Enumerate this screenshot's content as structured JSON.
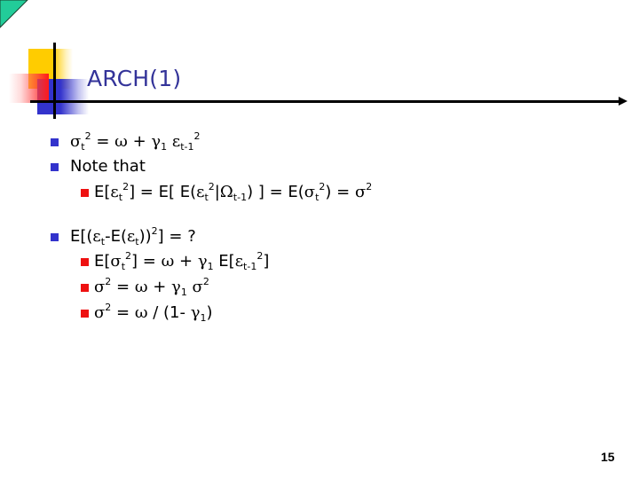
{
  "slide": {
    "title": "ARCH(1)",
    "page_number": "15",
    "colors": {
      "title": "#333399",
      "bullet_level1": "#3333cc",
      "bullet_level2": "#ee1111",
      "corner_triangle": "#22cc99"
    },
    "bullets": [
      {
        "level": 1,
        "parts": [
          {
            "t": "σ",
            "g": true
          },
          {
            "sub": "t"
          },
          {
            "sup": "2"
          },
          {
            "t": " = "
          },
          {
            "t": "ω",
            "g": true
          },
          {
            "t": " + "
          },
          {
            "t": "γ",
            "g": true
          },
          {
            "sub": "1"
          },
          {
            "t": " "
          },
          {
            "t": "ε",
            "g": true
          },
          {
            "sub": "t-1"
          },
          {
            "sup": "2"
          }
        ],
        "text": "σt2 = ω + γ1 εt-12"
      },
      {
        "level": 1,
        "parts": [
          {
            "t": "Note that"
          }
        ],
        "text": "Note that"
      },
      {
        "level": 2,
        "parts": [
          {
            "t": "E["
          },
          {
            "t": "ε",
            "g": true
          },
          {
            "sub": "t"
          },
          {
            "sup": "2"
          },
          {
            "t": "] = E[ E("
          },
          {
            "t": "ε",
            "g": true
          },
          {
            "sub": "t"
          },
          {
            "sup": "2"
          },
          {
            "t": "|"
          },
          {
            "t": "Ω",
            "g": true
          },
          {
            "sub": "t-1"
          },
          {
            "t": ") ] = E("
          },
          {
            "t": "σ",
            "g": true
          },
          {
            "sub": "t"
          },
          {
            "sup": "2"
          },
          {
            "t": ") = "
          },
          {
            "t": "σ",
            "g": true
          },
          {
            "sup": "2"
          }
        ],
        "text": "E[εt2] = E[ E(εt2|Ωt-1) ] = E(σt2) = σ2"
      },
      {
        "level": 1,
        "parts": [
          {
            "t": "E[("
          },
          {
            "t": "ε",
            "g": true
          },
          {
            "sub": "t"
          },
          {
            "t": "-E("
          },
          {
            "t": "ε",
            "g": true
          },
          {
            "sub": "t"
          },
          {
            "t": "))"
          },
          {
            "sup": "2"
          },
          {
            "t": "] = ?"
          }
        ],
        "text": "E[(εt-E(εt))2] = ?"
      },
      {
        "level": 2,
        "parts": [
          {
            "t": "E["
          },
          {
            "t": "σ",
            "g": true
          },
          {
            "sub": "t"
          },
          {
            "sup": "2"
          },
          {
            "t": "] = "
          },
          {
            "t": "ω",
            "g": true
          },
          {
            "t": " + "
          },
          {
            "t": "γ",
            "g": true
          },
          {
            "sub": "1"
          },
          {
            "t": " E["
          },
          {
            "t": "ε",
            "g": true
          },
          {
            "sub": "t-1"
          },
          {
            "sup": "2"
          },
          {
            "t": "]"
          }
        ],
        "text": "E[σt2] = ω + γ1 E[εt-12]"
      },
      {
        "level": 2,
        "parts": [
          {
            "t": "σ",
            "g": true
          },
          {
            "sup": "2"
          },
          {
            "t": " = "
          },
          {
            "t": "ω",
            "g": true
          },
          {
            "t": " + "
          },
          {
            "t": "γ",
            "g": true
          },
          {
            "sub": "1"
          },
          {
            "t": " "
          },
          {
            "t": "σ",
            "g": true
          },
          {
            "sup": "2"
          }
        ],
        "text": "σ2 = ω + γ1 σ2"
      },
      {
        "level": 2,
        "parts": [
          {
            "t": "σ",
            "g": true
          },
          {
            "sup": "2"
          },
          {
            "t": " = "
          },
          {
            "t": "ω",
            "g": true
          },
          {
            "t": " / (1- "
          },
          {
            "t": "γ",
            "g": true
          },
          {
            "sub": "1"
          },
          {
            "t": ")"
          }
        ],
        "text": "σ2 = ω / (1- γ1)"
      }
    ]
  }
}
